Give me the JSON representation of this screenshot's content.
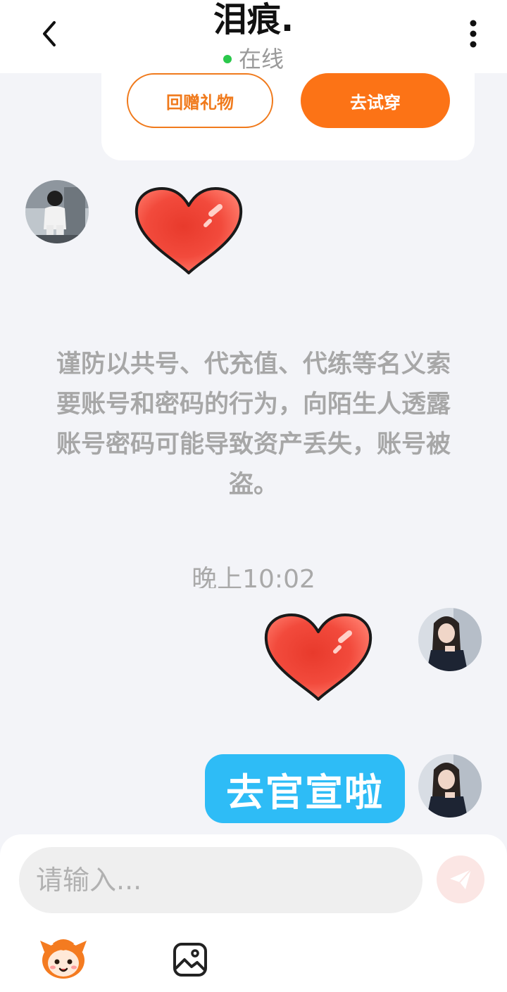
{
  "header": {
    "title": "泪痕.",
    "status_text": "在线",
    "back_icon": "chevron-left-icon",
    "more_icon": "more-vertical-icon"
  },
  "gift_card": {
    "return_gift_label": "回赠礼物",
    "try_on_label": "去试穿"
  },
  "notice": {
    "text": "谨防以共号、代充值、代练等名义索要账号和密码的行为，向陌生人透露账号密码可能导致资产丢失，账号被盗。"
  },
  "timestamp": "晚上10:02",
  "messages": [
    {
      "from": "other",
      "type": "sticker",
      "content": "heart-icon"
    },
    {
      "from": "self",
      "type": "sticker",
      "content": "heart-icon"
    },
    {
      "from": "self",
      "type": "text",
      "text": "去官宣啦"
    }
  ],
  "input": {
    "placeholder": "请输入..."
  },
  "toolbar": {
    "emoji_icon": "mascot-emoji-icon",
    "image_icon": "image-icon",
    "send_icon": "send-icon"
  },
  "colors": {
    "accent_orange": "#fc7316",
    "bubble_blue": "#2ebcf6",
    "online_green": "#2ac84b",
    "background": "#f3f4f8"
  }
}
